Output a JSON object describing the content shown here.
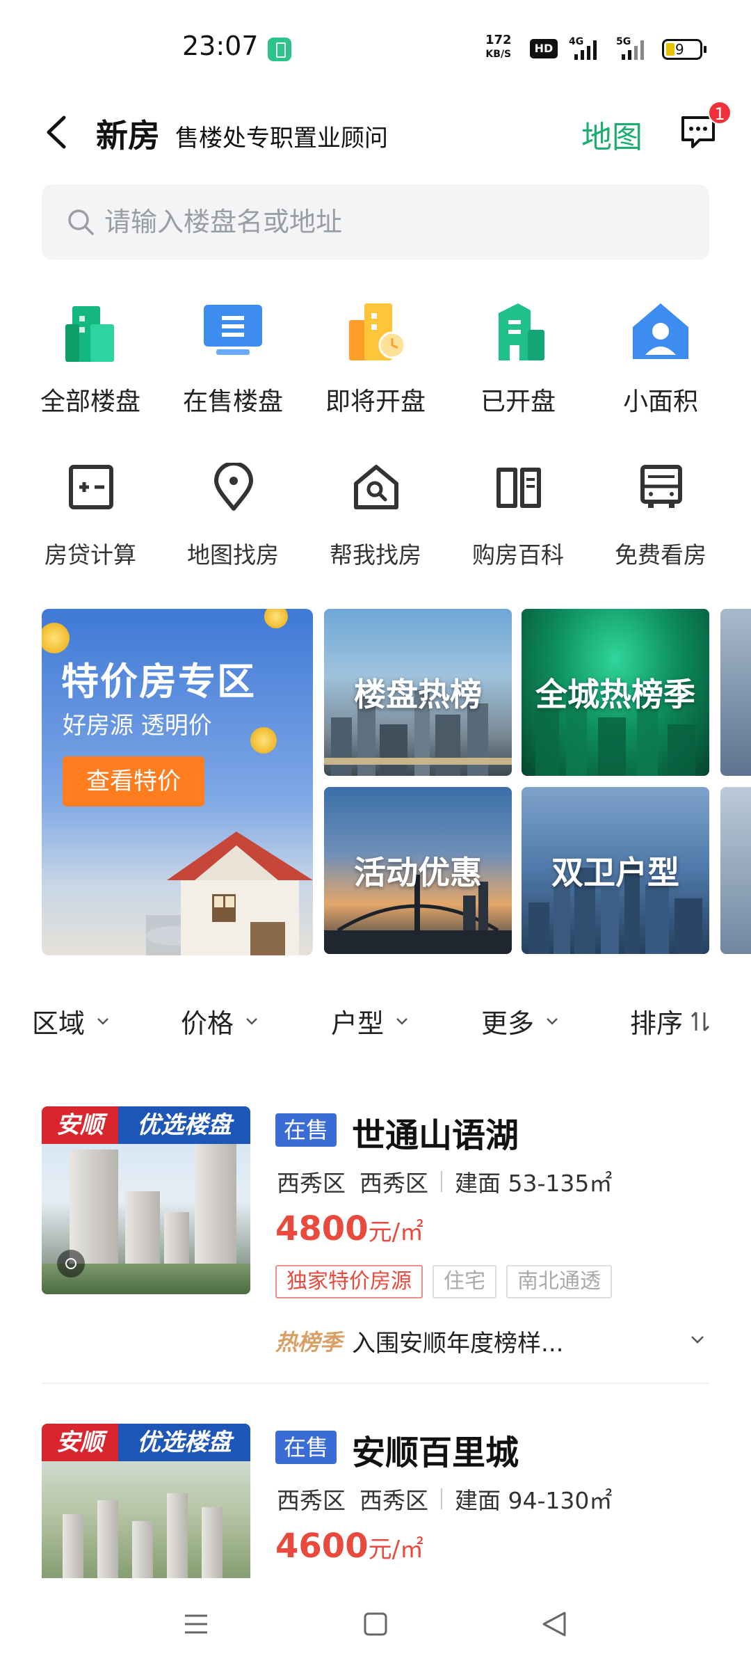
{
  "status_bar": {
    "time": "23:07",
    "speed_value": "172",
    "speed_unit": "KB/S",
    "hd_label": "HD",
    "sig1_label": "4G",
    "sig2_label": "5G",
    "battery_level": "9"
  },
  "header": {
    "title": "新房",
    "subtitle": "售楼处专职置业顾问",
    "map_label": "地图",
    "message_badge": "1"
  },
  "search": {
    "placeholder": "请输入楼盘名或地址"
  },
  "categories": [
    {
      "label": "全部楼盘",
      "icon": "buildings-icon"
    },
    {
      "label": "在售楼盘",
      "icon": "monitor-icon"
    },
    {
      "label": "即将开盘",
      "icon": "building-clock-icon"
    },
    {
      "label": "已开盘",
      "icon": "building-open-icon"
    },
    {
      "label": "小面积",
      "icon": "house-person-icon"
    }
  ],
  "tools": [
    {
      "label": "房贷计算",
      "icon": "calculator-icon"
    },
    {
      "label": "地图找房",
      "icon": "map-pin-icon"
    },
    {
      "label": "帮我找房",
      "icon": "house-search-icon"
    },
    {
      "label": "购房百科",
      "icon": "book-icon"
    },
    {
      "label": "免费看房",
      "icon": "bus-icon"
    }
  ],
  "promo": {
    "title": "特价房专区",
    "subtitle": "好房源 透明价",
    "button": "查看特价"
  },
  "tiles": [
    {
      "label": "楼盘热榜"
    },
    {
      "label": "全城热榜季"
    },
    {
      "label": "活动优惠"
    },
    {
      "label": "双卫户型"
    }
  ],
  "filters": {
    "area": "区域",
    "price": "价格",
    "layout": "户型",
    "more": "更多",
    "sort": "排序"
  },
  "listings": [
    {
      "tag_a": "安顺",
      "tag_b": "优选楼盘",
      "status": "在售",
      "name": "世通山语湖",
      "district1": "西秀区",
      "district2": "西秀区",
      "area": "建面 53-135㎡",
      "price": "4800",
      "price_unit": "元/㎡",
      "tags": [
        "独家特价房源",
        "住宅",
        "南北通透"
      ],
      "rank_badge": "热榜季",
      "rank_text": "入围安顺年度榜样..."
    },
    {
      "tag_a": "安顺",
      "tag_b": "优选楼盘",
      "status": "在售",
      "name": "安顺百里城",
      "district1": "西秀区",
      "district2": "西秀区",
      "area": "建面 94-130㎡",
      "price": "4600",
      "price_unit": "元/㎡"
    }
  ],
  "colors": {
    "accent_green": "#1cae6f",
    "price_red": "#e94a3e",
    "chip_blue": "#3b6cd6",
    "promo_orange": "#ff7d1e"
  }
}
